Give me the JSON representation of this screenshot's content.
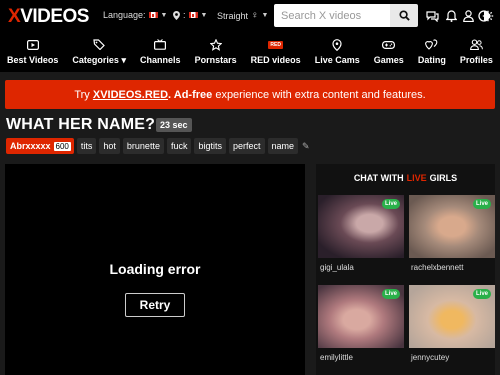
{
  "header": {
    "logo_x": "X",
    "logo_rest": "VIDEOS",
    "language_label": "Language:",
    "straight_label": "Straight",
    "search_placeholder": "Search X videos"
  },
  "nav": [
    {
      "label": "Best Videos",
      "icon": "play-box-icon"
    },
    {
      "label": "Categories ▾",
      "icon": "tags-icon"
    },
    {
      "label": "Channels",
      "icon": "tv-icon"
    },
    {
      "label": "Pornstars",
      "icon": "star-icon"
    },
    {
      "label": "RED videos",
      "icon": "red-tag-icon",
      "tag": "RED"
    },
    {
      "label": "Live Cams",
      "icon": "location-pin-icon"
    },
    {
      "label": "Games",
      "icon": "gamepad-icon"
    },
    {
      "label": "Dating",
      "icon": "hearts-icon"
    },
    {
      "label": "Profiles",
      "icon": "users-icon"
    }
  ],
  "banner": {
    "pre": "Try ",
    "link": "XVIDEOS.RED",
    "mid": ". Ad-free",
    "post": " experience with extra content and features."
  },
  "video": {
    "title": "WHAT HER NAME?",
    "duration": "23 sec",
    "uploader": "Abrxxxxx",
    "uploader_count": "600",
    "tags": [
      "tits",
      "hot",
      "brunette",
      "fuck",
      "bigtits",
      "perfect",
      "name"
    ],
    "error_text": "Loading error",
    "retry_label": "Retry"
  },
  "live": {
    "heading_pre": "CHAT WITH",
    "heading_hl": "LIVE",
    "heading_post": "GIRLS",
    "badge": "Live",
    "cams": [
      {
        "name": "gigi_ulala"
      },
      {
        "name": "rachelxbennett"
      },
      {
        "name": "emilylittle"
      },
      {
        "name": "jennycutey"
      }
    ]
  },
  "colors": {
    "accent": "#de2600",
    "live_green": "#2ab04a",
    "background": "#1a1a1a"
  }
}
